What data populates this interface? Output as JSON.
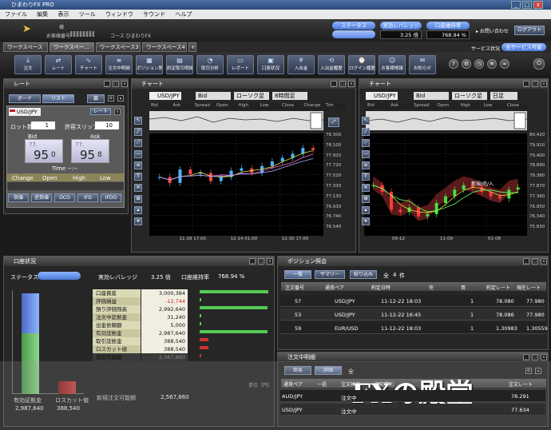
{
  "window": {
    "title": "ひまわりFX PRO"
  },
  "menu": [
    "ファイル",
    "編集",
    "表示",
    "ツール",
    "ウィンドウ",
    "サウンド",
    "ヘルプ"
  ],
  "header": {
    "user_label": "様",
    "account_label": "お客様番号",
    "course": "コース ひまわりFX",
    "status_label": "ステータス",
    "leverage_label": "実効レバレッジ",
    "leverage_value": "3.25 倍",
    "margin_label": "口座維持率",
    "margin_value": "768.94 %",
    "contact": "お問い合わせ",
    "logout": "ログアウト",
    "service_status": "サービス状況",
    "service_value": "全サービス可能"
  },
  "tabs": [
    "ワークスペース",
    "ワークスペー…",
    "ワークスペース3",
    "ワークスペース4",
    "+"
  ],
  "toolbar": [
    {
      "label": "注文",
      "icon": "↓"
    },
    {
      "label": "レート",
      "icon": "⇄"
    },
    {
      "label": "チャート",
      "icon": "∿"
    },
    {
      "label": "注文中明細",
      "icon": "≡"
    },
    {
      "label": "ポジション照会",
      "icon": "▦"
    },
    {
      "label": "約定取引明細",
      "icon": "▤"
    },
    {
      "label": "取引分析",
      "icon": "◔"
    },
    {
      "label": "レポート",
      "icon": "▭"
    },
    {
      "label": "口座状況",
      "icon": "▣"
    },
    {
      "label": "入出金",
      "icon": "¥"
    },
    {
      "label": "入出金履歴",
      "icon": "⟲"
    },
    {
      "label": "ログイン履歴",
      "icon": "⌚"
    },
    {
      "label": "お客様情報",
      "icon": "☺"
    },
    {
      "label": "お知らせ",
      "icon": "✉"
    }
  ],
  "rate_panel": {
    "title": "レート",
    "tabs": [
      "ボード",
      "リスト",
      "篇"
    ],
    "pair": "USD/JPY",
    "rate_btn": "レート",
    "lot_label": "ロット数",
    "lot_value": "1",
    "slip_label": "許容スリップ",
    "slip_value": "10",
    "bid_label": "Bid",
    "ask_label": "Ask",
    "bid_big": "77.",
    "bid_main": "95",
    "bid_small": "0",
    "ask_big": "77.",
    "ask_main": "95",
    "ask_small": "8",
    "time_label": "Time --:--",
    "cols": [
      "Change",
      "Open",
      "High",
      "Low"
    ],
    "buttons": [
      "指値",
      "逆指値",
      "OCO",
      "IFD",
      "IFDO"
    ]
  },
  "chart1": {
    "title": "チャート",
    "pair": "USD/JPY",
    "side": "Bid",
    "type": "ローソク足",
    "period": "8時間足",
    "tabs": [
      "Bid",
      "Ask",
      "Spread",
      "Open",
      "High",
      "Low",
      "Close",
      "Change",
      "Tim"
    ]
  },
  "chart2": {
    "title": "チャート",
    "pair": "USD/JPY",
    "side": "Bid",
    "type": "ローソク足",
    "period": "日足",
    "annot": "新規/売/入"
  },
  "chart_data": [
    {
      "type": "line",
      "title": "",
      "x": [
        "11-28 17:00",
        "12-14 01:00",
        "12-30 17:00"
      ],
      "ylabels": [
        "78.300",
        "78.100",
        "77.920",
        "77.720",
        "77.520",
        "77.330",
        "77.130",
        "76.930",
        "76.740",
        "76.540"
      ],
      "ylim": [
        76.54,
        78.3
      ],
      "series": [
        {
          "values": [
            77.55,
            77.45,
            77.68,
            77.6,
            77.62,
            77.48,
            77.55,
            77.66,
            77.7,
            77.62,
            77.74,
            77.82,
            77.88,
            77.95,
            78.05,
            78.02
          ]
        }
      ]
    },
    {
      "type": "line",
      "title": "",
      "x": [
        "09-12",
        "11-09",
        "01-08"
      ],
      "ylabels": [
        "80.420",
        "79.910",
        "79.400",
        "78.890",
        "78.380",
        "77.870",
        "77.360",
        "76.850",
        "76.340",
        "75.830"
      ],
      "ylim": [
        75.83,
        80.42
      ],
      "series": [
        {
          "values": [
            78.1,
            77.8,
            77.0,
            76.9,
            77.1,
            76.7,
            76.8,
            77.3,
            77.6,
            77.9,
            78.1,
            78.0,
            77.8,
            77.6,
            77.5,
            77.9,
            78.0
          ]
        }
      ]
    }
  ],
  "account_panel": {
    "title": "口座状況",
    "status_label": "ステータス",
    "leverage_label": "実効レバレッジ",
    "leverage_value": "3.25 倍",
    "margin_label": "口座維持率",
    "margin_value": "768.94 %",
    "rows": [
      {
        "label": "口座資産",
        "value": "3,000,384"
      },
      {
        "label": "評価損益",
        "value": "-12,744"
      },
      {
        "label": "預り評価残高",
        "value": "2,992,640"
      },
      {
        "label": "注文中証拠金",
        "value": "31,240"
      },
      {
        "label": "出金依頼額",
        "value": "5,000"
      },
      {
        "label": "有効証拠金",
        "value": "2,987,640"
      },
      {
        "label": "取引証拠金",
        "value": "388,540"
      },
      {
        "label": "ロスカット値",
        "value": "388,540"
      },
      {
        "label": "追加可能額",
        "value": "2,567,860"
      }
    ],
    "bar_labels": [
      "有効証拠金",
      "ロスカット値"
    ],
    "bar_values": [
      "2,987,640",
      "388,540"
    ],
    "new_order_label": "新規注文可能額",
    "new_order_value": "2,567,860",
    "unit": "単位（円）"
  },
  "position_panel": {
    "title": "ポジション照会",
    "tabs": [
      "一覧",
      "サマリー",
      "絞り込み"
    ],
    "count_label": "全",
    "count": "4",
    "count_unit": "件",
    "cols": [
      "注文番号",
      "通貨ペア",
      "約定日時",
      "売",
      "買",
      "約定レート",
      "現在レート"
    ],
    "rows": [
      {
        "id": "57",
        "pair": "USD/JPY",
        "time": "11-12-22 18:03",
        "sell": "",
        "buy": "1",
        "rate": "78.080",
        "now": "77.980"
      },
      {
        "id": "53",
        "pair": "USD/JPY",
        "time": "11-12-22 16:45",
        "sell": "",
        "buy": "1",
        "rate": "78.086",
        "now": "77.980"
      },
      {
        "id": "59",
        "pair": "EUR/USD",
        "time": "11-12-22 18:03",
        "sell": "",
        "buy": "1",
        "rate": "1.30983",
        "now": "1.30559"
      }
    ]
  },
  "order_panel": {
    "title": "注文中明細",
    "tabs": [
      "簡易",
      "詳細"
    ],
    "count_label": "全",
    "cols": [
      "通貨ペア",
      "一括",
      "注文状況",
      "注文種別",
      "売",
      "買",
      "注文レート"
    ],
    "rows": [
      {
        "pair": "AUD/JPY",
        "status": "注文中",
        "rate": "78.291"
      },
      {
        "pair": "USD/JPY",
        "status": "注文中",
        "rate": "77.634"
      }
    ]
  },
  "watermark": {
    "text": "FXの殿堂"
  }
}
